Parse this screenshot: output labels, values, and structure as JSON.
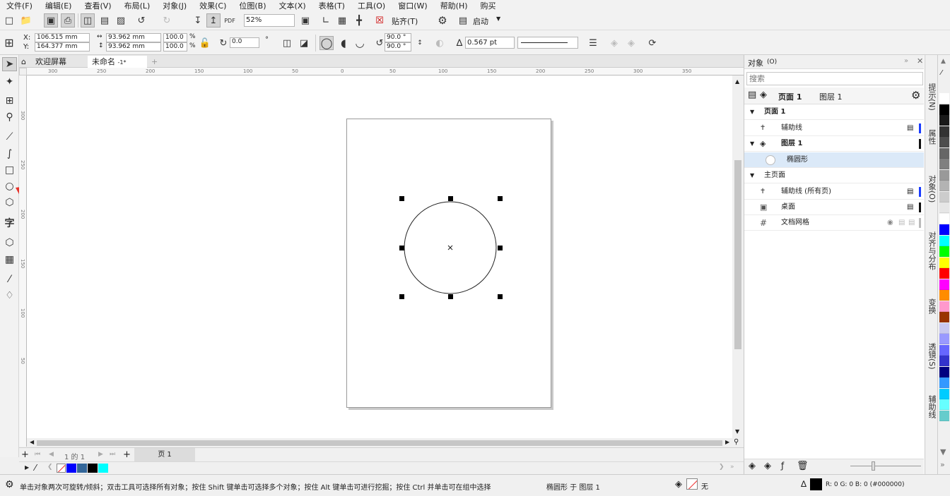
{
  "menu": [
    "文件(F)",
    "编辑(E)",
    "查看(V)",
    "布局(L)",
    "对象(J)",
    "效果(C)",
    "位图(B)",
    "文本(X)",
    "表格(T)",
    "工具(O)",
    "窗口(W)",
    "帮助(H)",
    "购买"
  ],
  "toolbar1": {
    "zoom": "52%",
    "snap_label": "贴齐(T)",
    "launch_label": "启动"
  },
  "toolbar2": {
    "x_label": "X:",
    "x_value": "106.515 mm",
    "y_label": "Y:",
    "y_value": "164.377 mm",
    "w_value": "93.962 mm",
    "h_value": "93.962 mm",
    "scale_w": "100.0",
    "scale_h": "100.0",
    "pct": "%",
    "pct2": "%",
    "rotation": "0.0",
    "deg": "°",
    "start_angle": "90.0 °",
    "end_angle": "90.0 °",
    "outline_width": "0.567 pt"
  },
  "tabs": {
    "welcome": "欢迎屏幕",
    "doc": "未命名",
    "doc_suffix": "-1*",
    "add": "+"
  },
  "ruler_h": [
    "300",
    "250",
    "200",
    "150",
    "100",
    "50",
    "0",
    "50",
    "100",
    "150",
    "200",
    "250",
    "300",
    "350"
  ],
  "ruler_v": [
    "300",
    "250",
    "200",
    "150",
    "100",
    "50"
  ],
  "pagebar": {
    "counter": "1 的 1",
    "page_tab": "页 1"
  },
  "status": {
    "hint": "单击对象两次可旋转/倾斜；双击工具可选择所有对象；按住 Shift 键单击可选择多个对象；按住 Alt 键单击可进行挖掘；按住 Ctrl 并单击可在组中选择",
    "object_info": "椭圆形 于 图层 1",
    "fill_none": "无",
    "color_info": "R:   0 G:   0 B:   0 (#000000)"
  },
  "docker": {
    "title": "对象",
    "title_suffix": "(O)",
    "search_placeholder": "搜索",
    "page_label": "页面 1",
    "layer_label": "图层 1",
    "tree": {
      "page1": "页面 1",
      "guides": "辅助线",
      "layer1": "图层 1",
      "ellipse": "椭圆形",
      "master": "主页面",
      "guides_all": "辅助线 (所有页)",
      "desktop": "桌面",
      "grid": "文档网格"
    }
  },
  "side_tabs": [
    "提示(N)",
    "属性",
    "对象(O)",
    "对齐与分布",
    "变换",
    "透镜(S)",
    "辅助线"
  ],
  "palette_colors": [
    "#ffffff",
    "#000000",
    "#1a1a1a",
    "#333333",
    "#4d4d4d",
    "#666666",
    "#808080",
    "#999999",
    "#b3b3b3",
    "#cccccc",
    "#e6e6e6",
    "#ffffff",
    "#0000ff",
    "#00ffff",
    "#00ff00",
    "#ffff00",
    "#ff0000",
    "#ff00ff",
    "#ff8c00",
    "#ff99cc",
    "#993300",
    "#c8c8f0",
    "#9999ff",
    "#6666ff",
    "#3333cc",
    "#000080",
    "#3399ff",
    "#00ccff",
    "#66ffff",
    "#66cccc"
  ],
  "bottom_swatches": [
    "#0000ff",
    "#336699",
    "#000000",
    "#00ffff"
  ]
}
